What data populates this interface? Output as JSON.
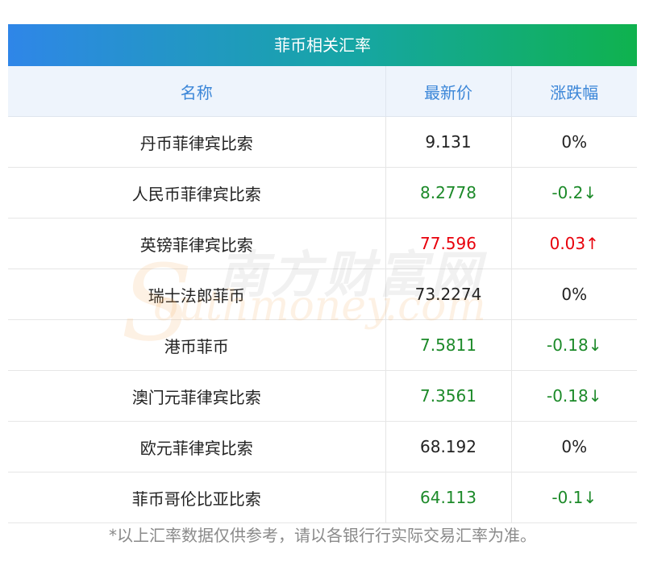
{
  "title": "菲币相关汇率",
  "headers": {
    "name": "名称",
    "price": "最新价",
    "change": "涨跌幅"
  },
  "rows": [
    {
      "name": "丹币菲律宾比索",
      "price": "9.131",
      "change": "0%",
      "trend": "flat"
    },
    {
      "name": "人民币菲律宾比索",
      "price": "8.2778",
      "change": "-0.2↓",
      "trend": "down"
    },
    {
      "name": "英镑菲律宾比索",
      "price": "77.596",
      "change": "0.03↑",
      "trend": "up"
    },
    {
      "name": "瑞士法郎菲币",
      "price": "73.2274",
      "change": "0%",
      "trend": "flat"
    },
    {
      "name": "港币菲币",
      "price": "7.5811",
      "change": "-0.18↓",
      "trend": "down"
    },
    {
      "name": "澳门元菲律宾比索",
      "price": "7.3561",
      "change": "-0.18↓",
      "trend": "down"
    },
    {
      "name": "欧元菲律宾比索",
      "price": "68.192",
      "change": "0%",
      "trend": "flat"
    },
    {
      "name": "菲币哥伦比亚比索",
      "price": "64.113",
      "change": "-0.1↓",
      "trend": "down"
    }
  ],
  "watermark": {
    "cn": "南方财富网",
    "en": "outhmoney.com",
    "s": "S"
  },
  "footnote": "*以上汇率数据仅供参考，请以各银行行实际交易汇率为准。",
  "colors": {
    "up": "#e8000b",
    "down": "#1c8a29",
    "header_text": "#3b86d8"
  }
}
